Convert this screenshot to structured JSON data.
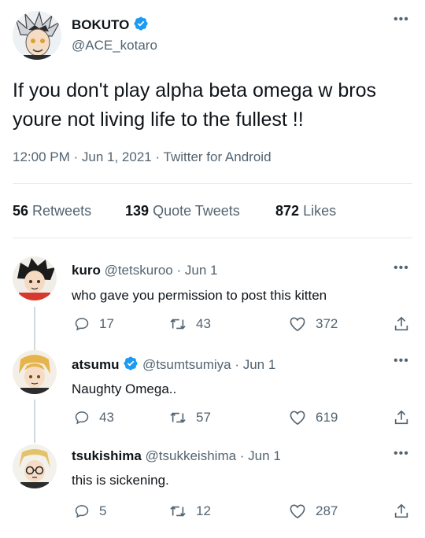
{
  "main_tweet": {
    "display_name": "BOKUTO",
    "handle": "@ACE_kotaro",
    "text": "If you don't play alpha beta omega w bros youre not living life to the fullest !!",
    "timestamp": "12:00 PM · Jun 1, 2021 · Twitter for Android",
    "stats": {
      "retweets_count": "56",
      "retweets_label": "Retweets",
      "quotes_count": "139",
      "quotes_label": "Quote Tweets",
      "likes_count": "872",
      "likes_label": "Likes"
    }
  },
  "replies": [
    {
      "display_name": "kuro",
      "handle": "@tetskuroo",
      "date": "· Jun 1",
      "verified": false,
      "text": "who gave you permission to post this kitten",
      "replies": "17",
      "retweets": "43",
      "likes": "372"
    },
    {
      "display_name": "atsumu",
      "handle": "@tsumtsumiya",
      "date": "· Jun 1",
      "verified": true,
      "text": "Naughty Omega..",
      "replies": "43",
      "retweets": "57",
      "likes": "619"
    },
    {
      "display_name": "tsukishima",
      "handle": "@tsukkeishima",
      "date": "· Jun 1",
      "verified": false,
      "text": "this is sickening.",
      "replies": "5",
      "retweets": "12",
      "likes": "287"
    }
  ],
  "colors": {
    "accent": "#1d9bf0",
    "muted": "#536471",
    "text": "#0f1419",
    "divider": "#e5e8eb"
  }
}
